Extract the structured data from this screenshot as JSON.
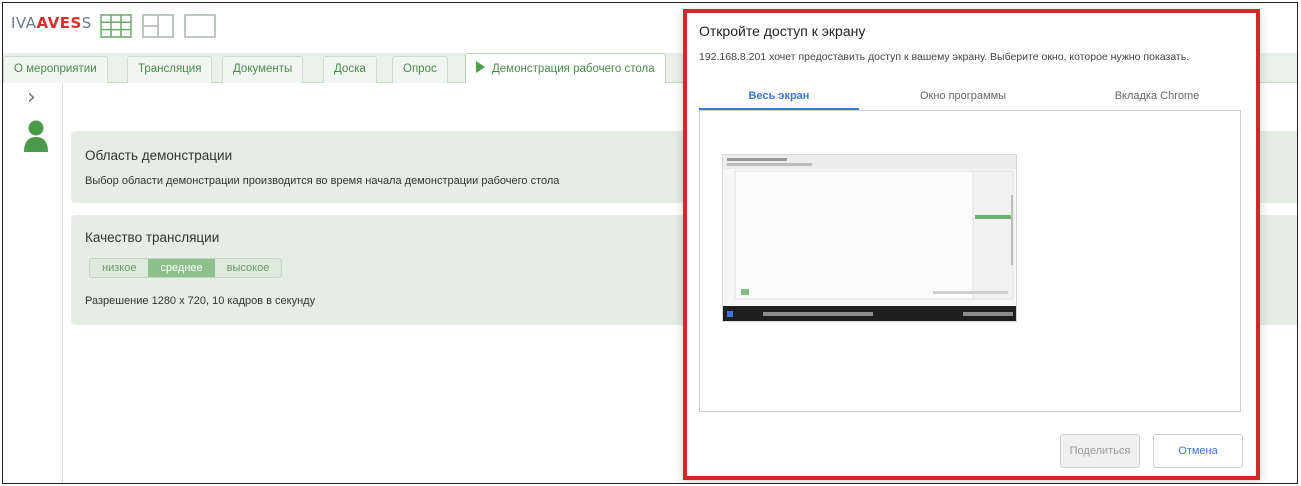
{
  "header": {
    "logo_iva": "IVA",
    "logo_aves": "AVES",
    "logo_s": "S",
    "layout_icons": [
      "grid-layout-icon",
      "split-layout-icon",
      "single-layout-icon"
    ]
  },
  "tabs": [
    {
      "label": "О мероприятии"
    },
    {
      "label": "Трансляция"
    },
    {
      "label": "Документы"
    },
    {
      "label": "Доска"
    },
    {
      "label": "Опрос"
    },
    {
      "label": "Демонстрация рабочего стола",
      "active": true
    }
  ],
  "rail": {
    "expand_icon": "chevron-right-icon",
    "user_icon": "user-icon"
  },
  "demo_area": {
    "title": "Область демонстрации",
    "text": "Выбор области демонстрации производится во время начала демонстрации рабочего стола"
  },
  "quality": {
    "title": "Качество трансляции",
    "options": [
      "низкое",
      "среднее",
      "высокое"
    ],
    "selected": "среднее",
    "resolution": "Разрешение 1280 х 720, 10 кадров в секунду"
  },
  "dialog": {
    "title": "Откройте доступ к экрану",
    "description": "192.168.8.201 хочет предоставить доступ к вашему экрану. Выберите окно, которое нужно показать.",
    "tabs": [
      "Весь экран",
      "Окно программы",
      "Вкладка Chrome"
    ],
    "active_tab": "Весь экран",
    "share_label": "Поделиться",
    "cancel_label": "Отмена"
  },
  "colors": {
    "accent_green": "#4aa14a",
    "highlight_red": "#d7262b",
    "link_blue": "#3c78d8"
  }
}
